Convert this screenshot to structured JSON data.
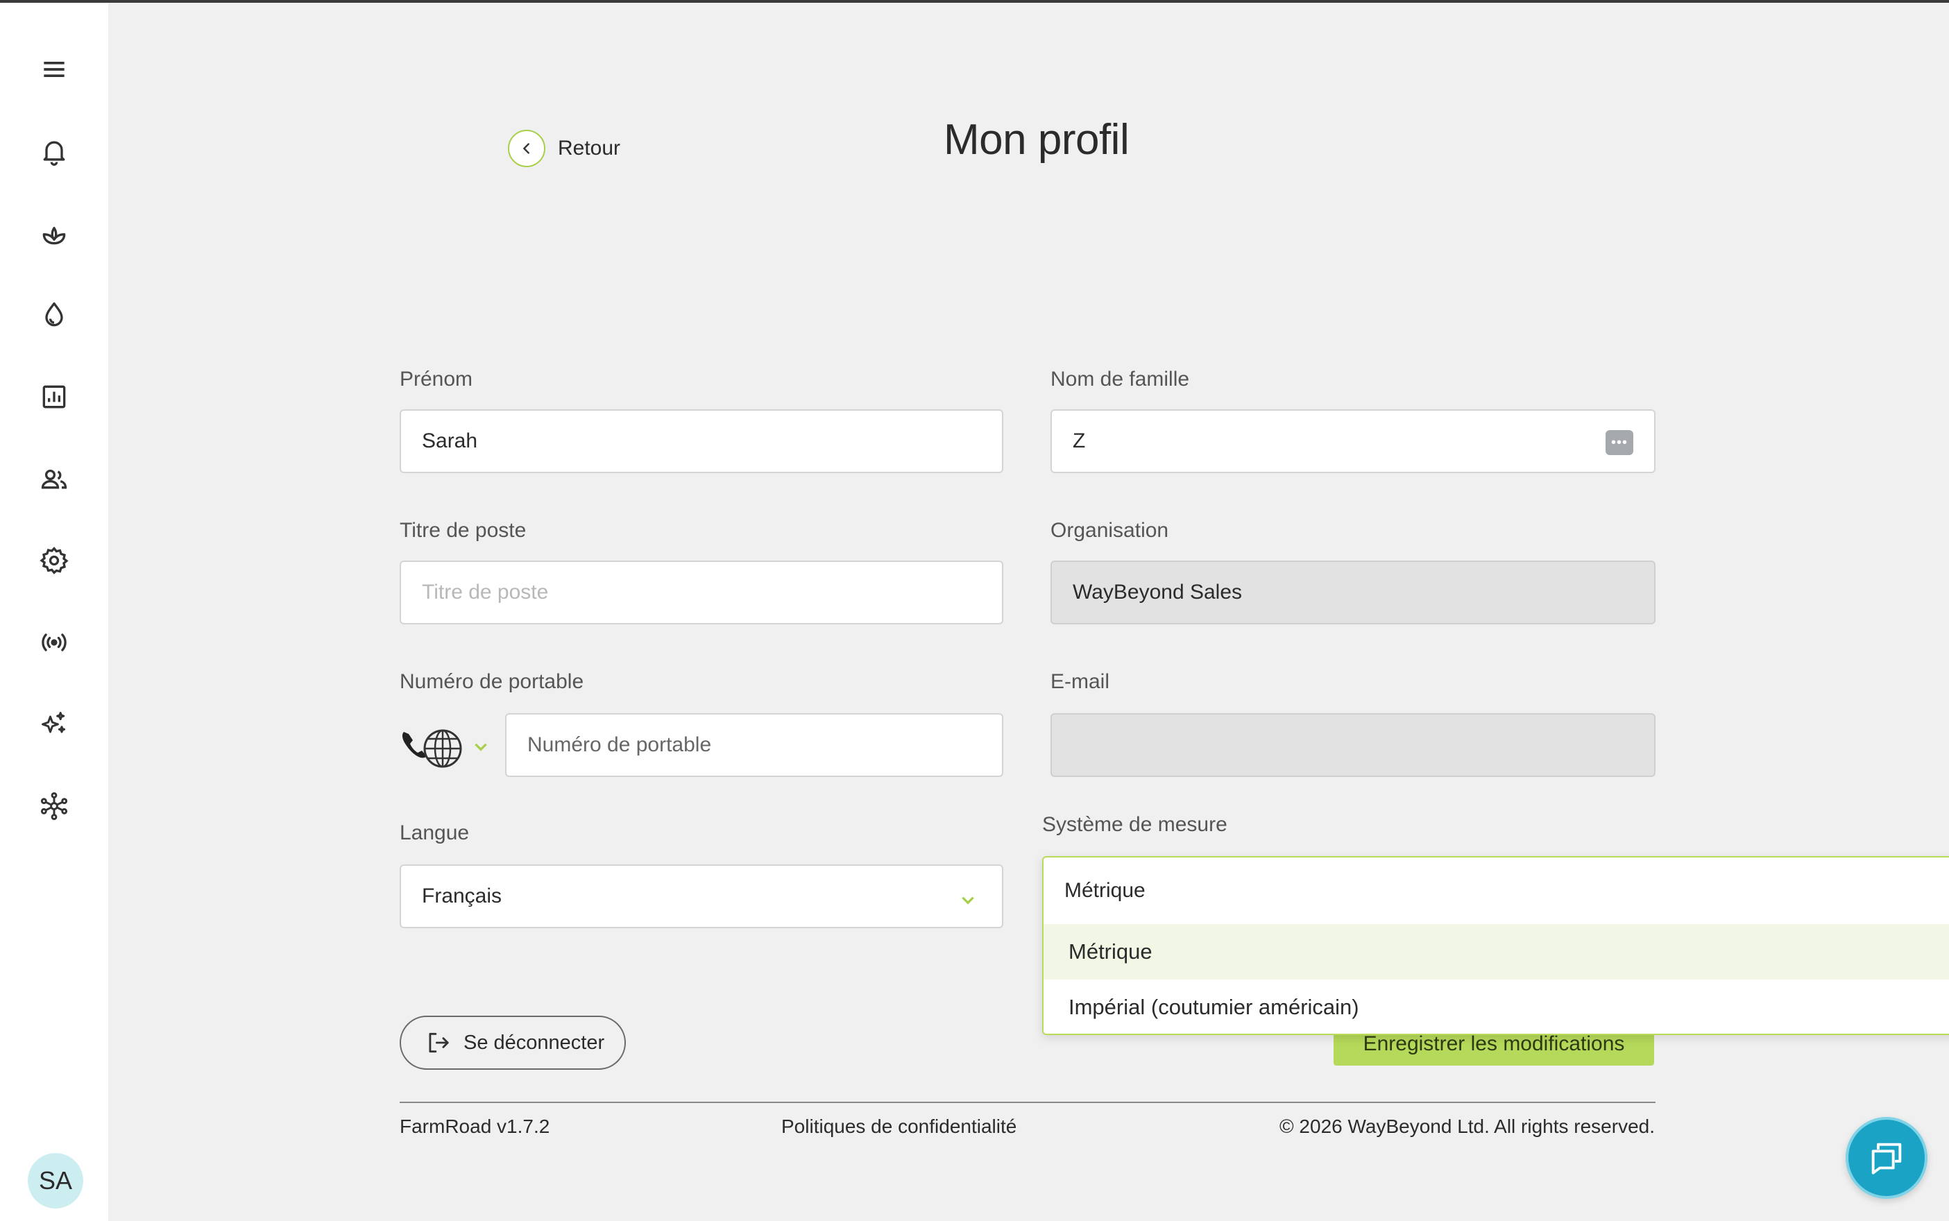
{
  "sidebar": {
    "items": [
      {
        "name": "menu-icon"
      },
      {
        "name": "bell-icon"
      },
      {
        "name": "plant-icon"
      },
      {
        "name": "water-drop-icon"
      },
      {
        "name": "chart-icon"
      },
      {
        "name": "users-icon"
      },
      {
        "name": "gear-icon"
      },
      {
        "name": "broadcast-icon"
      },
      {
        "name": "sparkles-icon"
      },
      {
        "name": "network-icon"
      }
    ],
    "avatar_initials": "SA"
  },
  "header": {
    "back_label": "Retour",
    "title": "Mon profil"
  },
  "form": {
    "first_name": {
      "label": "Prénom",
      "value": "Sarah"
    },
    "last_name": {
      "label": "Nom de famille",
      "value": "Z"
    },
    "job_title": {
      "label": "Titre de poste",
      "placeholder": "Titre de poste"
    },
    "organisation": {
      "label": "Organisation",
      "value": "WayBeyond Sales"
    },
    "mobile": {
      "label": "Numéro de portable",
      "placeholder": "Numéro de portable"
    },
    "email": {
      "label": "E-mail",
      "value": ""
    },
    "language": {
      "label": "Langue",
      "value": "Français"
    },
    "measure_system": {
      "label": "Système de mesure",
      "value": "Métrique",
      "options": [
        "Métrique",
        "Impérial (coutumier américain)"
      ]
    }
  },
  "actions": {
    "logout_label": "Se déconnecter",
    "save_label": "Enregistrer les modifications"
  },
  "footer": {
    "version": "FarmRoad v1.7.2",
    "privacy": "Politiques de confidentialité",
    "copyright": "© 2026 WayBeyond Ltd. All rights reserved."
  },
  "colors": {
    "accent": "#b5d95a",
    "chat": "#1aa3c5"
  }
}
